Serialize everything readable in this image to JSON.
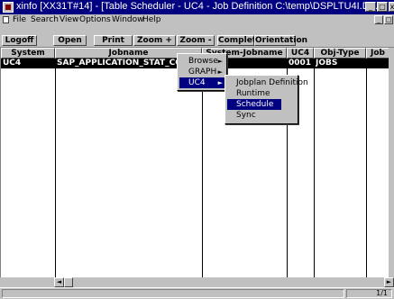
{
  "window": {
    "title": "xinfo [XX31T#14] - [Table Scheduler - UC4 - Job Definition C:\\temp\\DSPLTU4I.D...",
    "min": "_",
    "max": "□",
    "close": "x"
  },
  "menubar": {
    "items": [
      "File",
      "Search",
      "View",
      "Options",
      "Window",
      "Help"
    ]
  },
  "toolbar": {
    "buttons": [
      "Logoff",
      "Open",
      "Print",
      "Zoom +",
      "Zoom -",
      "Complete",
      "Orientation"
    ]
  },
  "table": {
    "columns": [
      "System",
      "Jobname",
      "System-Jobname",
      "UC4",
      "Obj-Type",
      "Job"
    ],
    "rows": [
      {
        "system": "UC4",
        "jobname": "SAP_APPLICATION_STAT_COLLECTO",
        "system_jobname": "",
        "uc4": "0001",
        "objtype": "JOBS",
        "job": ""
      }
    ]
  },
  "context_menu": {
    "items": [
      {
        "label": "Browse",
        "submenu": true
      },
      {
        "label": "GRAPH",
        "submenu": true
      },
      {
        "label": "UC4",
        "submenu": true,
        "selected": true
      }
    ]
  },
  "submenu": {
    "items": [
      {
        "label": "Jobplan Definition"
      },
      {
        "label": "Runtime"
      },
      {
        "label": "Schedule",
        "selected": true
      },
      {
        "label": "Sync"
      }
    ]
  },
  "scroll": {
    "left": "◄",
    "right": "►"
  },
  "status": {
    "page": "1/1"
  }
}
